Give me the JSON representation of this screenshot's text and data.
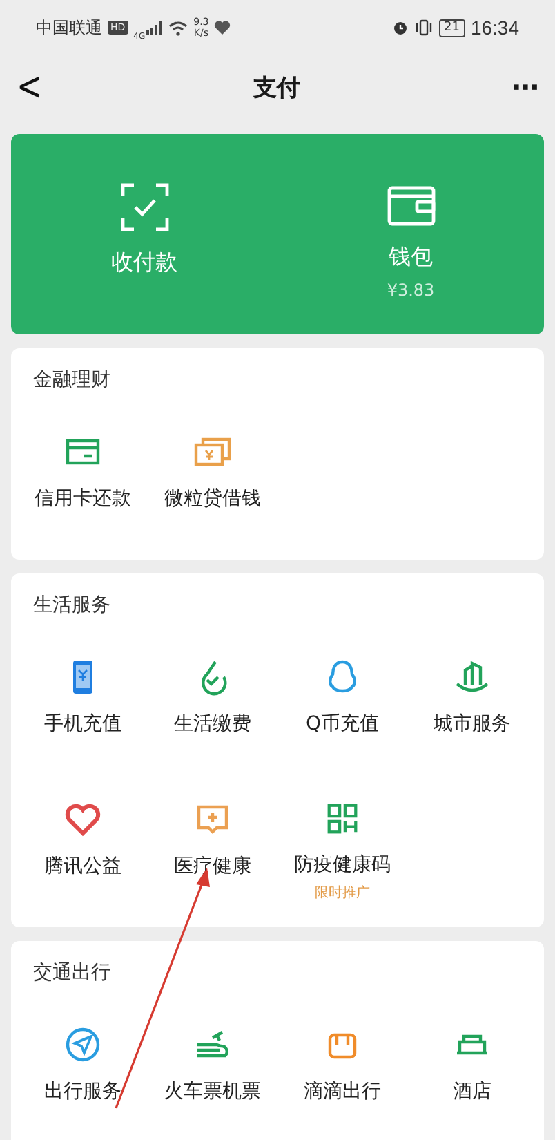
{
  "status_bar": {
    "carrier": "中国联通",
    "hd": "HD",
    "network": "4G",
    "speed_value": "9.3",
    "speed_unit": "K/s",
    "battery": "21",
    "time": "16:34"
  },
  "nav": {
    "back": "<",
    "title": "支付",
    "more": "···"
  },
  "wallet_card": {
    "actions": [
      {
        "kind": "scan",
        "label": "收付款"
      },
      {
        "kind": "wallet",
        "label": "钱包",
        "sub": "¥3.83"
      }
    ]
  },
  "sections": [
    {
      "title": "金融理财",
      "items": [
        {
          "kind": "card",
          "label": "信用卡还款"
        },
        {
          "kind": "loan",
          "label": "微粒贷借钱"
        }
      ]
    },
    {
      "title": "生活服务",
      "items": [
        {
          "kind": "phone",
          "label": "手机充值"
        },
        {
          "kind": "bill",
          "label": "生活缴费"
        },
        {
          "kind": "penguin",
          "label": "Q币充值"
        },
        {
          "kind": "city",
          "label": "城市服务"
        },
        {
          "kind": "heart",
          "label": "腾讯公益"
        },
        {
          "kind": "medical",
          "label": "医疗健康"
        },
        {
          "kind": "qr",
          "label": "防疫健康码",
          "note": "限时推广"
        }
      ]
    },
    {
      "title": "交通出行",
      "items": [
        {
          "kind": "navigate",
          "label": "出行服务"
        },
        {
          "kind": "train",
          "label": "火车票机票"
        },
        {
          "kind": "car",
          "label": "滴滴出行"
        },
        {
          "kind": "hotel",
          "label": "酒店"
        }
      ]
    }
  ]
}
